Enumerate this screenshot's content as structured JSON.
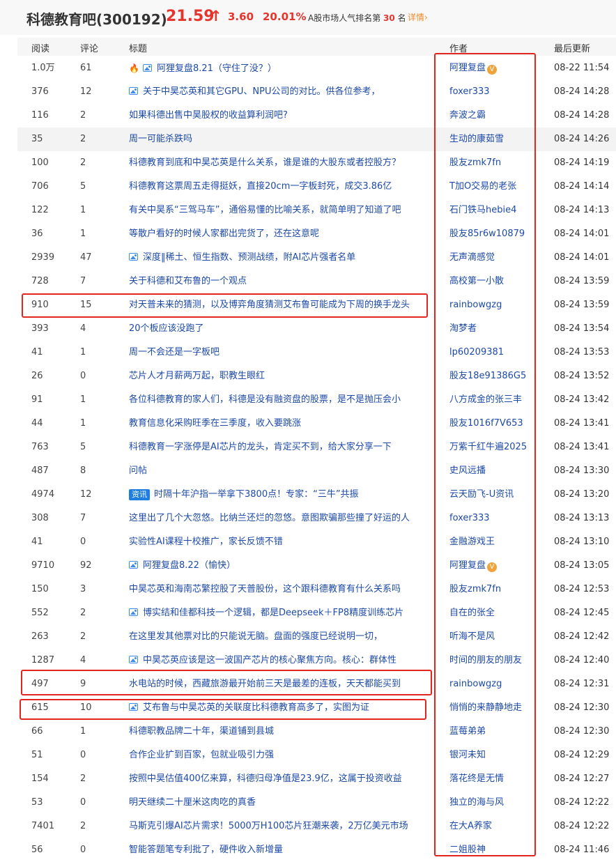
{
  "header": {
    "stock_name": "科德教育吧(300192)",
    "price": "21.59",
    "arrow": "↑",
    "change": "3.60",
    "change_pct": "20.01%",
    "rank_prefix": "A股市场人气排名第",
    "rank_num": "30",
    "rank_suffix": "名",
    "detail_link": "详情",
    "detail_arrow": "›"
  },
  "columns": {
    "read": "阅读",
    "comment": "评论",
    "title": "标题",
    "author": "作者",
    "updated": "最后更新"
  },
  "badges": {
    "news_tag": "资讯",
    "v_badge": "V"
  },
  "colors": {
    "accent_red": "#e5352d",
    "link_blue": "#1d4aa8",
    "detail_orange": "#f08a24",
    "highlight_box": "#e2261d"
  },
  "posts": [
    {
      "read": "1.0万",
      "comment": "61",
      "title": "阿狸复盘8.21（守住了没？）",
      "author": "阿狸复盘",
      "time": "08-22 11:54",
      "icons": [
        "fire-icon",
        "image-icon"
      ],
      "verified": true
    },
    {
      "read": "376",
      "comment": "12",
      "title": "关于中昊芯英和其它GPU、NPU公司的对比。供各位参考，",
      "author": "foxer333",
      "time": "08-24 14:28",
      "icons": [
        "image-icon"
      ]
    },
    {
      "read": "116",
      "comment": "2",
      "title": "如果科德出售中昊股权的收益算利润吧?",
      "author": "奔波之霸",
      "time": "08-24 14:28",
      "icons": []
    },
    {
      "read": "35",
      "comment": "2",
      "title": "周一可能杀跌吗",
      "author": "生动的康茹雪",
      "time": "08-24 14:26",
      "icons": [],
      "highlighted": true
    },
    {
      "read": "100",
      "comment": "2",
      "title": "科德教育到底和中昊芯英是什么关系，谁是谁的大股东或者控股方？",
      "author": "股友zmk7fn",
      "time": "08-24 14:19",
      "icons": []
    },
    {
      "read": "706",
      "comment": "5",
      "title": "科德教育这票周五走得挺妖，直接20cm一字板封死，成交3.86亿",
      "author": "T加O交易的老张",
      "time": "08-24 14:14",
      "icons": []
    },
    {
      "read": "122",
      "comment": "1",
      "title": "有关中昊系“三驾马车”，通俗易懂的比喻关系，就简单明了知道了吧",
      "author": "石门铁马hebie4",
      "time": "08-24 14:13",
      "icons": []
    },
    {
      "read": "36",
      "comment": "1",
      "title": "等散户看好的时候人家都出完货了，还在这意呢",
      "author": "股友85r6w10879",
      "time": "08-24 14:01",
      "icons": []
    },
    {
      "read": "2939",
      "comment": "47",
      "title": "深度‖稀土、恒生指数、预测战绩，附AI芯片强者名单",
      "author": "无声滴感觉",
      "time": "08-24 14:01",
      "icons": [
        "image-icon"
      ]
    },
    {
      "read": "728",
      "comment": "7",
      "title": "关于科德和艾布鲁的一个观点",
      "author": "高校第一小散",
      "time": "08-24 13:59",
      "icons": []
    },
    {
      "read": "910",
      "comment": "15",
      "title": "对天普未来的猜测，以及博弈角度猜测艾布鲁可能成为下周的换手龙头",
      "author": "rainbowgzg",
      "time": "08-24 13:59",
      "icons": []
    },
    {
      "read": "393",
      "comment": "4",
      "title": "20个板应该没跑了",
      "author": "淘梦者",
      "time": "08-24 13:54",
      "icons": []
    },
    {
      "read": "41",
      "comment": "1",
      "title": "周一不会还是一字板吧",
      "author": "lp60209381",
      "time": "08-24 13:53",
      "icons": []
    },
    {
      "read": "26",
      "comment": "0",
      "title": "芯片人才月薪两万起，职教生眼红",
      "author": "股友18e91386G5",
      "time": "08-24 13:52",
      "icons": []
    },
    {
      "read": "91",
      "comment": "1",
      "title": "各位科德教育的家人们，科德是没有融资盘的股票，是不是抛压会小",
      "author": "八方成金的张三丰",
      "time": "08-24 13:42",
      "icons": []
    },
    {
      "read": "44",
      "comment": "1",
      "title": "教育信息化采购旺季在三季度，收入要跳涨",
      "author": "股友1016f7V653",
      "time": "08-24 13:41",
      "icons": []
    },
    {
      "read": "763",
      "comment": "5",
      "title": "科德教育一字涨停是AI芯片的龙头，肯定买不到，给大家分享一下",
      "author": "万紫千红牛遍2025",
      "time": "08-24 13:41",
      "icons": []
    },
    {
      "read": "487",
      "comment": "8",
      "title": "问帖",
      "author": "史风远播",
      "time": "08-24 13:30",
      "icons": []
    },
    {
      "read": "4974",
      "comment": "12",
      "title": "时隔十年沪指一举拿下3800点！专家：“三牛”共振",
      "author": "云天励飞-U资讯",
      "time": "08-24 13:20",
      "icons": [
        "news-tag"
      ]
    },
    {
      "read": "308",
      "comment": "7",
      "title": "这里出了几个大忽悠。比纳兰还烂的忽悠。意图欺骗那些撞了好运的人",
      "author": "foxer333",
      "time": "08-24 13:13",
      "icons": []
    },
    {
      "read": "41",
      "comment": "0",
      "title": "实验性AI课程十校推广，家长反馈不错",
      "author": "金融游戏王",
      "time": "08-24 13:10",
      "icons": []
    },
    {
      "read": "9710",
      "comment": "92",
      "title": "阿狸复盘8.22（愉快）",
      "author": "阿狸复盘",
      "time": "08-24 13:05",
      "icons": [
        "image-icon"
      ],
      "verified": true
    },
    {
      "read": "150",
      "comment": "3",
      "title": "中昊芯英和海南芯繁控股了天普股份，这个跟科德教育有什么关系吗",
      "author": "股友zmk7fn",
      "time": "08-24 12:53",
      "icons": []
    },
    {
      "read": "552",
      "comment": "2",
      "title": "博实结和佳都科技一个逻辑，都是Deepseek＋FP8精度训练芯片",
      "author": "自在的张全",
      "time": "08-24 12:45",
      "icons": [
        "image-icon"
      ]
    },
    {
      "read": "263",
      "comment": "2",
      "title": "在这里发其他票对比的只能说无脑。盘面的强度已经说明一切，",
      "author": "听海不是风",
      "time": "08-24 12:42",
      "icons": []
    },
    {
      "read": "1287",
      "comment": "4",
      "title": "中昊芯英应该是这一波国产芯片的核心聚焦方向。核心：群体性",
      "author": "时间的朋友的朋友",
      "time": "08-24 12:40",
      "icons": [
        "image-icon"
      ]
    },
    {
      "read": "497",
      "comment": "9",
      "title": "水电站的时候，西藏旅游最开始前三天是最差的连板，天天都能买到",
      "author": "rainbowgzg",
      "time": "08-24 12:31",
      "icons": []
    },
    {
      "read": "615",
      "comment": "10",
      "title": "艾布鲁与中昊芯英的关联度比科德教育高多了，实图为证",
      "author": "悄悄的来静静地走",
      "time": "08-24 12:30",
      "icons": [
        "image-icon"
      ]
    },
    {
      "read": "66",
      "comment": "1",
      "title": "科德职教品牌二十年，渠道铺到县城",
      "author": "蓝莓弟弟",
      "time": "08-24 12:30",
      "icons": []
    },
    {
      "read": "51",
      "comment": "0",
      "title": "合作企业扩到百家，包就业吸引力强",
      "author": "银河未知",
      "time": "08-24 12:29",
      "icons": []
    },
    {
      "read": "154",
      "comment": "2",
      "title": "按照中昊估值400亿来算，科德归母净值是23.9亿，这属于投资收益",
      "author": "落花终是无情",
      "time": "08-24 12:27",
      "icons": []
    },
    {
      "read": "53",
      "comment": "0",
      "title": "明天继续二十厘米这肉吃的真香",
      "author": "独立的海与风",
      "time": "08-24 12:22",
      "icons": []
    },
    {
      "read": "7401",
      "comment": "2",
      "title": "马斯克引爆AI芯片需求！5000万H100芯片狂潮来袭，2万亿美元市场",
      "author": "在大A养家",
      "time": "08-24 12:22",
      "icons": []
    },
    {
      "read": "56",
      "comment": "0",
      "title": "智能答题笔专利批了，硬件收入新增量",
      "author": "二姐股神",
      "time": "08-24 11:46",
      "icons": []
    }
  ]
}
